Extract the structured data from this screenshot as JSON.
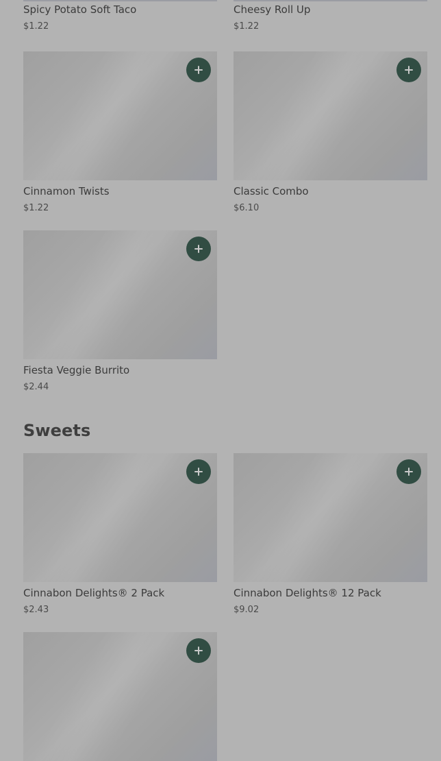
{
  "sections": [
    {
      "title": "",
      "items": [
        {
          "name": "Spicy Potato Soft Taco",
          "price": "$1.22",
          "add_label": "+"
        },
        {
          "name": "Cheesy Roll Up",
          "price": "$1.22",
          "add_label": "+"
        },
        {
          "name": "Cinnamon Twists",
          "price": "$1.22",
          "add_label": "+"
        },
        {
          "name": "Classic Combo",
          "price": "$6.10",
          "add_label": "+"
        },
        {
          "name": "Fiesta Veggie Burrito",
          "price": "$2.44",
          "add_label": "+"
        }
      ]
    },
    {
      "title": "Sweets",
      "items": [
        {
          "name": "Cinnabon Delights® 2 Pack",
          "price": "$2.43",
          "add_label": "+"
        },
        {
          "name": "Cinnabon Delights® 12 Pack",
          "price": "$9.02",
          "add_label": "+"
        },
        {
          "name": "",
          "price": "",
          "add_label": "+"
        }
      ]
    }
  ],
  "colors": {
    "overlay_background": "#b3b3b3",
    "add_button": "#314d43",
    "image_placeholder": "#a5a5a5"
  },
  "icons": {
    "add": "plus-icon"
  }
}
